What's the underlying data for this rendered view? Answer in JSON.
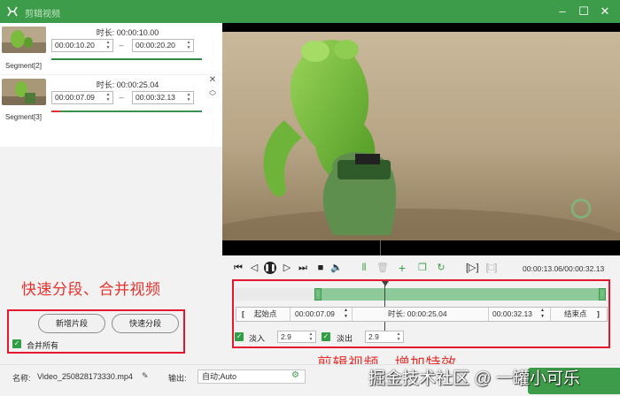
{
  "window": {
    "title": "剪辑视频",
    "minimize_icon": "minimize-icon",
    "maximize_icon": "maximize-icon",
    "close_icon": "close-icon",
    "accent": "#3d9c49"
  },
  "segments": [
    {
      "name": "Segment[2]",
      "duration_label": "时长: 00:00:10.00",
      "start": "00:00:10.20",
      "end": "00:00:20.20"
    },
    {
      "name": "Segment[3]",
      "duration_label": "时长: 00:00:25.04",
      "start": "00:00:07.09",
      "end": "00:00:32.13"
    }
  ],
  "overlay": {
    "left_caption": "快速分段、合并视频",
    "right_caption": "剪辑视频、增加特效"
  },
  "segment_actions": {
    "add_segment": "新增片段",
    "quick_split": "快速分段",
    "merge_all": "合并所有"
  },
  "player": {
    "time_readout": "00:00:13.06/00:00:32.13"
  },
  "editor": {
    "start_bracket": "[",
    "start_label": "起始点",
    "start_value": "00:00:07.09",
    "duration_label": "时长: 00:00:25.04",
    "end_value": "00:00:32.13",
    "end_label": "结束点",
    "end_bracket": "]",
    "fade_in_label": "淡入",
    "fade_in_value": "2.9",
    "fade_out_label": "淡出",
    "fade_out_value": "2.9"
  },
  "bottom": {
    "name_label": "名称:",
    "file_name": "Video_250828173330.mp4",
    "output_label": "输出:",
    "output_value": "自动;Auto"
  },
  "watermark": {
    "text": "掘金技术社区 @ 一罐小可乐"
  }
}
